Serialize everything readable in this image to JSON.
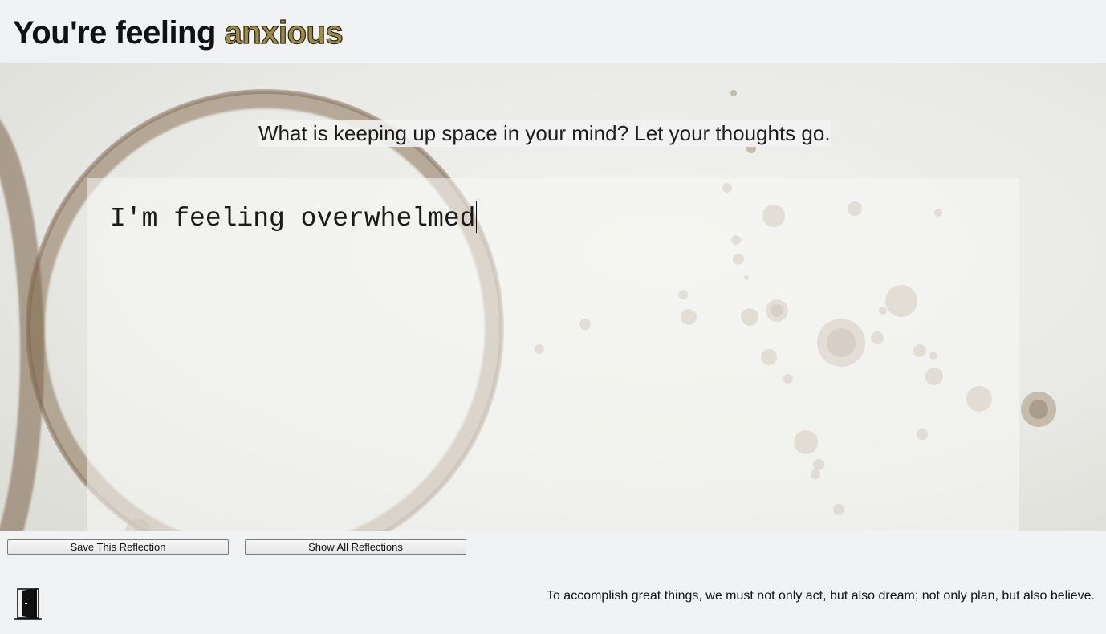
{
  "header": {
    "title_prefix": "You're feeling ",
    "mood": "anxious"
  },
  "main": {
    "prompt": "What is keeping up space in your mind? Let your thoughts go.",
    "entry_text": "I'm feeling overwhelmed"
  },
  "actions": {
    "save_label": "Save This Reflection",
    "show_label": "Show All Reflections"
  },
  "footer": {
    "exit_icon": "door-exit-icon",
    "quote": "To accomplish great things, we must not only act, but also dream; not only plan, but also believe."
  },
  "colors": {
    "page_background": "#f1f2f4",
    "mood_accent": "#a08c46",
    "stain": "#9a8568"
  }
}
